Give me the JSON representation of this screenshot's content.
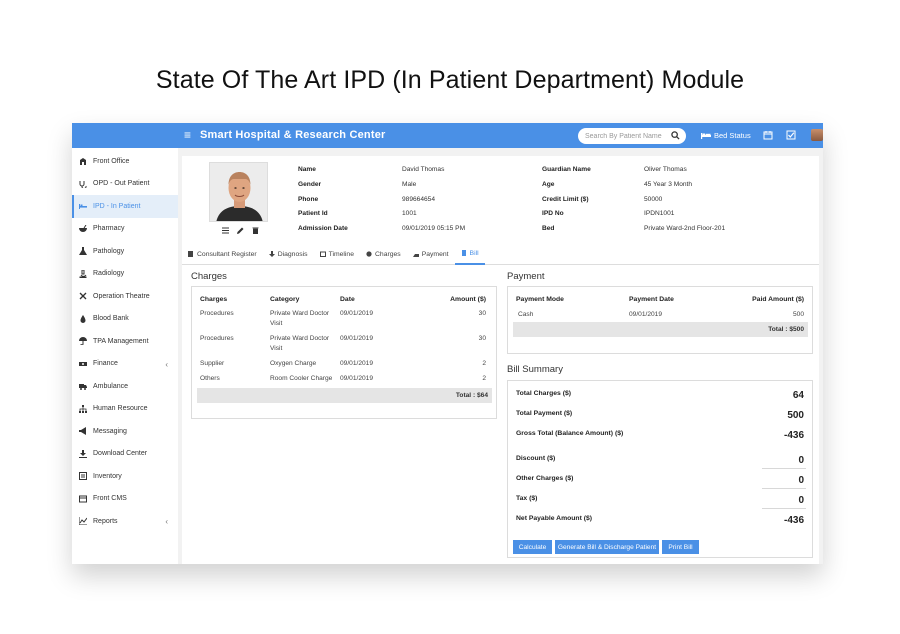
{
  "page_title": "State Of The Art IPD (In Patient Department) Module",
  "header": {
    "brand": "Smart Hospital & Research Center",
    "search_placeholder": "Search By Patient Name",
    "bed_status": "Bed Status",
    "accent": "#4a90e6"
  },
  "sidebar": {
    "items": [
      {
        "label": "Front Office",
        "icon": "front-office-icon"
      },
      {
        "label": "OPD - Out Patient",
        "icon": "stethoscope-icon"
      },
      {
        "label": "IPD - In Patient",
        "icon": "bed-icon"
      },
      {
        "label": "Pharmacy",
        "icon": "mortar-icon"
      },
      {
        "label": "Pathology",
        "icon": "flask-icon"
      },
      {
        "label": "Radiology",
        "icon": "microscope-icon"
      },
      {
        "label": "Operation Theatre",
        "icon": "scissors-icon"
      },
      {
        "label": "Blood Bank",
        "icon": "blood-drop-icon"
      },
      {
        "label": "TPA Management",
        "icon": "umbrella-icon"
      },
      {
        "label": "Finance",
        "icon": "money-icon"
      },
      {
        "label": "Ambulance",
        "icon": "ambulance-icon"
      },
      {
        "label": "Human Resource",
        "icon": "sitemap-icon"
      },
      {
        "label": "Messaging",
        "icon": "megaphone-icon"
      },
      {
        "label": "Download Center",
        "icon": "download-icon"
      },
      {
        "label": "Inventory",
        "icon": "inventory-icon"
      },
      {
        "label": "Front CMS",
        "icon": "cms-icon"
      },
      {
        "label": "Reports",
        "icon": "chart-icon"
      }
    ]
  },
  "patient": {
    "left": [
      {
        "label": "Name",
        "value": "David Thomas"
      },
      {
        "label": "Gender",
        "value": "Male"
      },
      {
        "label": "Phone",
        "value": "989664654"
      },
      {
        "label": "Patient Id",
        "value": "1001"
      },
      {
        "label": "Admission Date",
        "value": "09/01/2019 05:15 PM"
      }
    ],
    "right": [
      {
        "label": "Guardian Name",
        "value": "Oliver Thomas"
      },
      {
        "label": "Age",
        "value": "45 Year 3 Month"
      },
      {
        "label": "Credit Limit ($)",
        "value": "50000"
      },
      {
        "label": "IPD No",
        "value": "IPDN1001"
      },
      {
        "label": "Bed",
        "value": "Private Ward-2nd Floor-201"
      }
    ]
  },
  "tabs": [
    {
      "label": "Consultant Register"
    },
    {
      "label": "Diagnosis"
    },
    {
      "label": "Timeline"
    },
    {
      "label": "Charges"
    },
    {
      "label": "Payment"
    },
    {
      "label": "Bill"
    }
  ],
  "charges": {
    "title": "Charges",
    "headers": [
      "Charges",
      "Category",
      "Date",
      "Amount ($)"
    ],
    "rows": [
      {
        "charge": "Procedures",
        "category1": "Private Ward Doctor",
        "category2": "Visit",
        "date": "09/01/2019",
        "amount": "30"
      },
      {
        "charge": "Procedures",
        "category1": "Private Ward Doctor",
        "category2": "Visit",
        "date": "09/01/2019",
        "amount": "30"
      },
      {
        "charge": "Supplier",
        "category1": "Oxygen Charge",
        "category2": "",
        "date": "09/01/2019",
        "amount": "2"
      },
      {
        "charge": "Others",
        "category1": "Room Cooler Charge",
        "category2": "",
        "date": "09/01/2019",
        "amount": "2"
      }
    ],
    "total": "Total : $64"
  },
  "payment": {
    "title": "Payment",
    "headers": [
      "Payment Mode",
      "Payment Date",
      "Paid Amount ($)"
    ],
    "rows": [
      {
        "mode": "Cash",
        "date": "09/01/2019",
        "amount": "500"
      }
    ],
    "total": "Total : $500"
  },
  "bill_summary": {
    "title": "Bill Summary",
    "rows": [
      {
        "label": "Total Charges ($)",
        "value": "64"
      },
      {
        "label": "Total Payment ($)",
        "value": "500"
      },
      {
        "label": "Gross Total (Balance Amount) ($)",
        "value": "-436"
      },
      {
        "label": "Discount ($)",
        "value": "0"
      },
      {
        "label": "Other Charges ($)",
        "value": "0"
      },
      {
        "label": "Tax ($)",
        "value": "0"
      },
      {
        "label": "Net Payable Amount ($)",
        "value": "-436"
      }
    ],
    "buttons": {
      "calculate": "Calculate",
      "generate": "Generate Bill & Discharge Patient",
      "print": "Print Bill"
    }
  }
}
